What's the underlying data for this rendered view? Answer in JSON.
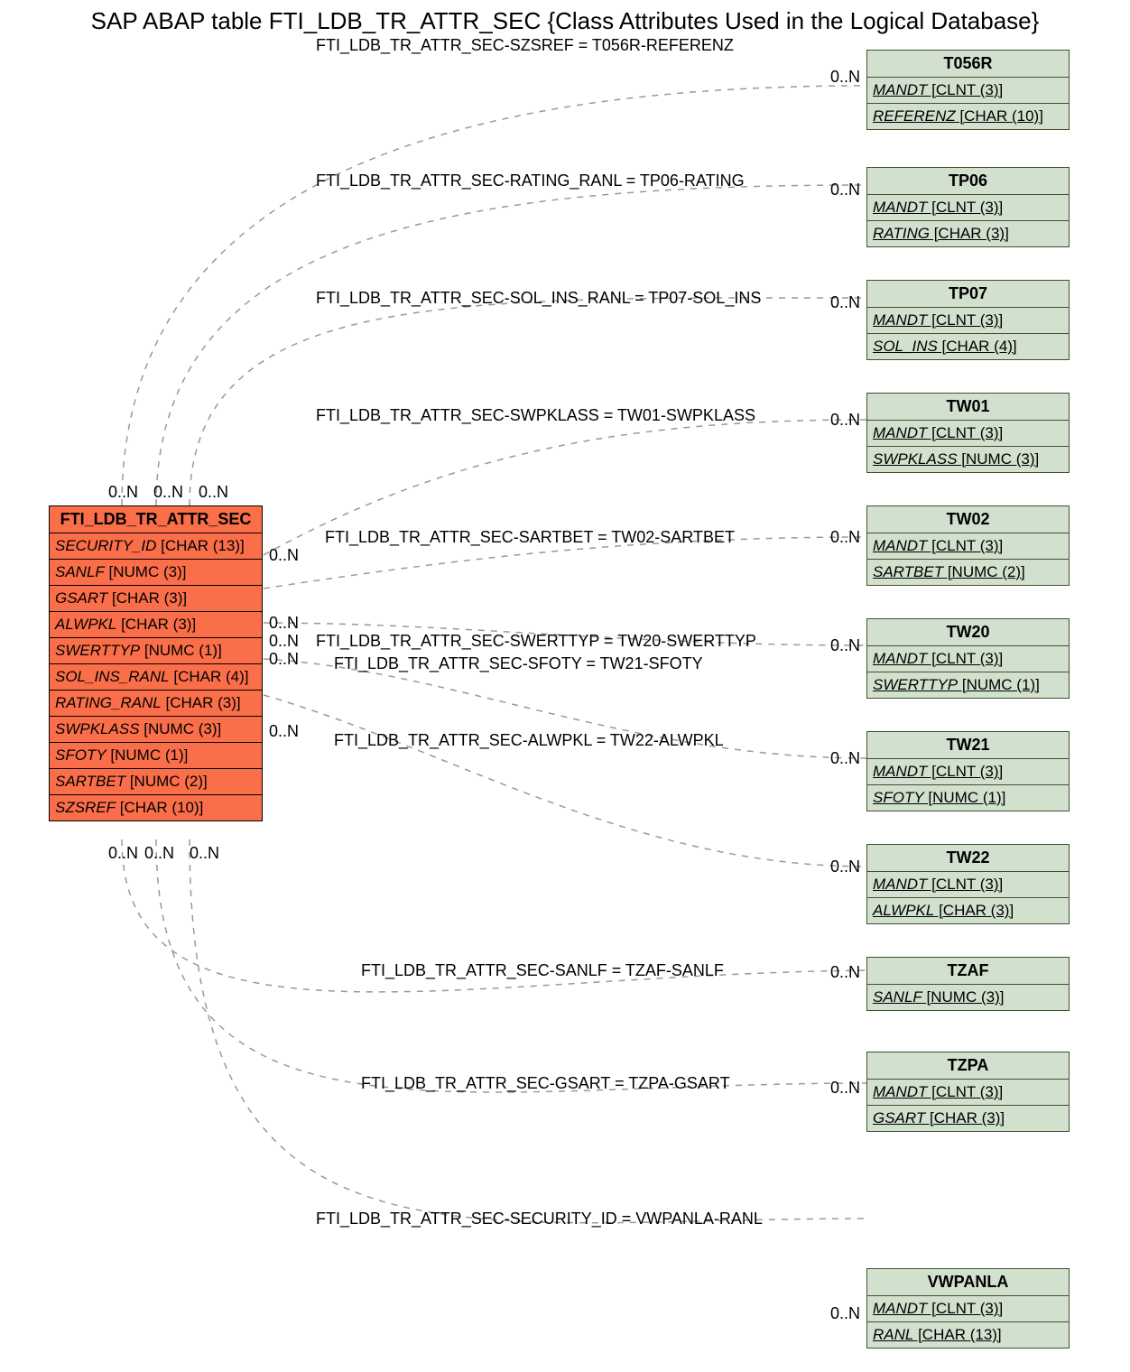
{
  "title": "SAP ABAP table FTI_LDB_TR_ATTR_SEC {Class Attributes Used in the Logical Database}",
  "mainTable": {
    "name": "FTI_LDB_TR_ATTR_SEC",
    "fields": [
      {
        "name": "SECURITY_ID",
        "type": "[CHAR (13)]"
      },
      {
        "name": "SANLF",
        "type": "[NUMC (3)]"
      },
      {
        "name": "GSART",
        "type": "[CHAR (3)]"
      },
      {
        "name": "ALWPKL",
        "type": "[CHAR (3)]"
      },
      {
        "name": "SWERTTYP",
        "type": "[NUMC (1)]"
      },
      {
        "name": "SOL_INS_RANL",
        "type": "[CHAR (4)]"
      },
      {
        "name": "RATING_RANL",
        "type": "[CHAR (3)]"
      },
      {
        "name": "SWPKLASS",
        "type": "[NUMC (3)]"
      },
      {
        "name": "SFOTY",
        "type": "[NUMC (1)]"
      },
      {
        "name": "SARTBET",
        "type": "[NUMC (2)]"
      },
      {
        "name": "SZSREF",
        "type": "[CHAR (10)]"
      }
    ]
  },
  "refTables": [
    {
      "name": "T056R",
      "fields": [
        {
          "name": "MANDT",
          "type": "[CLNT (3)]"
        },
        {
          "name": "REFERENZ",
          "type": "[CHAR (10)]"
        }
      ]
    },
    {
      "name": "TP06",
      "fields": [
        {
          "name": "MANDT",
          "type": "[CLNT (3)]"
        },
        {
          "name": "RATING",
          "type": "[CHAR (3)]"
        }
      ]
    },
    {
      "name": "TP07",
      "fields": [
        {
          "name": "MANDT",
          "type": "[CLNT (3)]"
        },
        {
          "name": "SOL_INS",
          "type": "[CHAR (4)]"
        }
      ]
    },
    {
      "name": "TW01",
      "fields": [
        {
          "name": "MANDT",
          "type": "[CLNT (3)]"
        },
        {
          "name": "SWPKLASS",
          "type": "[NUMC (3)]"
        }
      ]
    },
    {
      "name": "TW02",
      "fields": [
        {
          "name": "MANDT",
          "type": "[CLNT (3)]"
        },
        {
          "name": "SARTBET",
          "type": "[NUMC (2)]"
        }
      ]
    },
    {
      "name": "TW20",
      "fields": [
        {
          "name": "MANDT",
          "type": "[CLNT (3)]"
        },
        {
          "name": "SWERTTYP",
          "type": "[NUMC (1)]"
        }
      ]
    },
    {
      "name": "TW21",
      "fields": [
        {
          "name": "MANDT",
          "type": "[CLNT (3)]"
        },
        {
          "name": "SFOTY",
          "type": "[NUMC (1)]"
        }
      ]
    },
    {
      "name": "TW22",
      "fields": [
        {
          "name": "MANDT",
          "type": "[CLNT (3)]"
        },
        {
          "name": "ALWPKL",
          "type": "[CHAR (3)]"
        }
      ]
    },
    {
      "name": "TZAF",
      "fields": [
        {
          "name": "SANLF",
          "type": "[NUMC (3)]"
        }
      ]
    },
    {
      "name": "TZPA",
      "fields": [
        {
          "name": "MANDT",
          "type": "[CLNT (3)]"
        },
        {
          "name": "GSART",
          "type": "[CHAR (3)]"
        }
      ]
    },
    {
      "name": "VWPANLA",
      "fields": [
        {
          "name": "MANDT",
          "type": "[CLNT (3)]"
        },
        {
          "name": "RANL",
          "type": "[CHAR (13)]"
        }
      ]
    }
  ],
  "edges": [
    {
      "label": "FTI_LDB_TR_ATTR_SEC-SZSREF = T056R-REFERENZ",
      "card": "0..N"
    },
    {
      "label": "FTI_LDB_TR_ATTR_SEC-RATING_RANL = TP06-RATING",
      "card": "0..N"
    },
    {
      "label": "FTI_LDB_TR_ATTR_SEC-SOL_INS_RANL = TP07-SOL_INS",
      "card": "0..N"
    },
    {
      "label": "FTI_LDB_TR_ATTR_SEC-SWPKLASS = TW01-SWPKLASS",
      "card": "0..N"
    },
    {
      "label": "FTI_LDB_TR_ATTR_SEC-SARTBET = TW02-SARTBET",
      "card": "0..N"
    },
    {
      "label": "FTI_LDB_TR_ATTR_SEC-SWERTTYP = TW20-SWERTTYP",
      "card": "0..N"
    },
    {
      "label": "FTI_LDB_TR_ATTR_SEC-SFOTY = TW21-SFOTY",
      "card": "0..N"
    },
    {
      "label": "FTI_LDB_TR_ATTR_SEC-ALWPKL = TW22-ALWPKL",
      "card": "0..N"
    },
    {
      "label": "FTI_LDB_TR_ATTR_SEC-SANLF = TZAF-SANLF",
      "card": "0..N"
    },
    {
      "label": "FTI_LDB_TR_ATTR_SEC-GSART = TZPA-GSART",
      "card": "0..N"
    },
    {
      "label": "FTI_LDB_TR_ATTR_SEC-SECURITY_ID = VWPANLA-RANL",
      "card": "0..N"
    }
  ],
  "srcTopCards": [
    "0..N",
    "0..N",
    "0..N"
  ],
  "srcBottomCards": [
    "0..N",
    "0..N",
    "0..N"
  ],
  "srcRightCards": [
    "0..N",
    "0..N",
    "0..N",
    "0..N",
    "0..N"
  ]
}
